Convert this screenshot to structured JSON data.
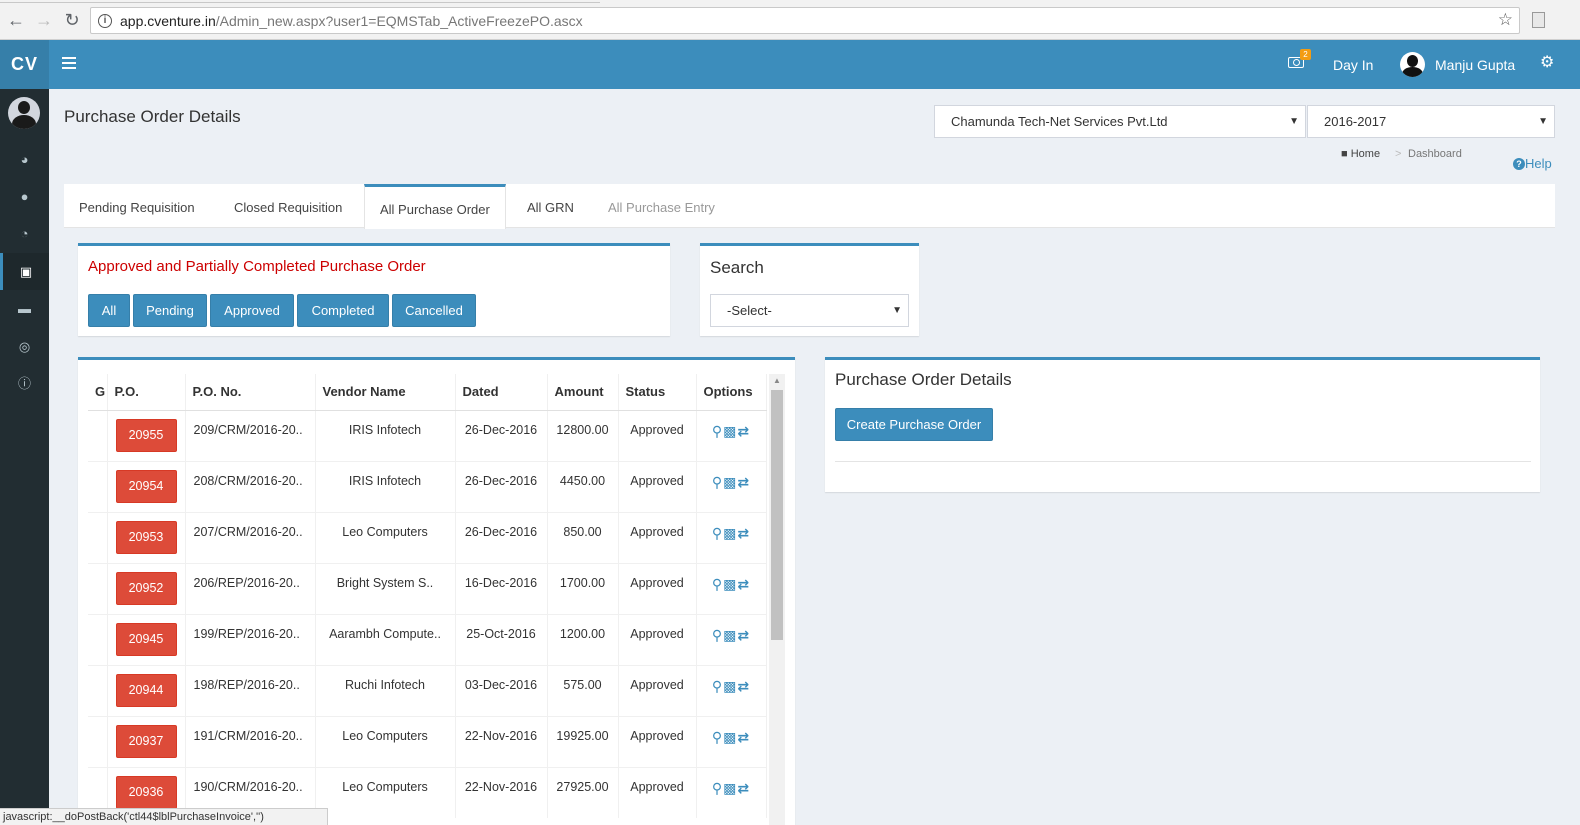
{
  "browser": {
    "url_host": "app.cventure.in",
    "url_path": "/Admin_new.aspx?user1=EQMSTab_ActiveFreezePO.ascx"
  },
  "header": {
    "logo": "CV",
    "notification_count": "2",
    "day_in": "Day In",
    "user_name": "Manju Gupta"
  },
  "sidebar": {
    "items": [
      {
        "icon": "dashboard-icon"
      },
      {
        "icon": "user-icon"
      },
      {
        "icon": "pie-chart-icon"
      },
      {
        "icon": "shopping-cart-icon",
        "active": true
      },
      {
        "icon": "credit-card-icon"
      },
      {
        "icon": "globe-icon"
      },
      {
        "icon": "info-icon"
      }
    ]
  },
  "page": {
    "title": "Purchase Order Details",
    "company_select": "Chamunda Tech-Net Services Pvt.Ltd",
    "year_select": "2016-2017",
    "breadcrumb_home": "Home",
    "breadcrumb_sep": ">",
    "breadcrumb_current": "Dashboard",
    "help": "Help"
  },
  "tabs": [
    {
      "label": "Pending Requisition"
    },
    {
      "label": "Closed Requisition"
    },
    {
      "label": "All Purchase Order"
    },
    {
      "label": "All GRN"
    },
    {
      "label": "All Purchase Entry"
    }
  ],
  "filter": {
    "title": "Approved and Partially Completed Purchase Order",
    "buttons": [
      "All",
      "Pending",
      "Approved",
      "Completed",
      "Cancelled"
    ]
  },
  "search": {
    "title": "Search",
    "select_value": "-Select-"
  },
  "table": {
    "headers": [
      "G",
      "P.O.",
      "P.O. No.",
      "Vendor Name",
      "Dated",
      "Amount",
      "Status",
      "Options"
    ],
    "rows": [
      {
        "po": "20955",
        "po_no": "209/CRM/2016-20..",
        "vendor": "IRIS Infotech",
        "dated": "26-Dec-2016",
        "amount": "12800.00",
        "status": "Approved"
      },
      {
        "po": "20954",
        "po_no": "208/CRM/2016-20..",
        "vendor": "IRIS Infotech",
        "dated": "26-Dec-2016",
        "amount": "4450.00",
        "status": "Approved"
      },
      {
        "po": "20953",
        "po_no": "207/CRM/2016-20..",
        "vendor": "Leo Computers",
        "dated": "26-Dec-2016",
        "amount": "850.00",
        "status": "Approved"
      },
      {
        "po": "20952",
        "po_no": "206/REP/2016-20..",
        "vendor": "Bright System S..",
        "dated": "16-Dec-2016",
        "amount": "1700.00",
        "status": "Approved"
      },
      {
        "po": "20945",
        "po_no": "199/REP/2016-20..",
        "vendor": "Aarambh Compute..",
        "dated": "25-Oct-2016",
        "amount": "1200.00",
        "status": "Approved"
      },
      {
        "po": "20944",
        "po_no": "198/REP/2016-20..",
        "vendor": "Ruchi Infotech",
        "dated": "03-Dec-2016",
        "amount": "575.00",
        "status": "Approved"
      },
      {
        "po": "20937",
        "po_no": "191/CRM/2016-20..",
        "vendor": "Leo Computers",
        "dated": "22-Nov-2016",
        "amount": "19925.00",
        "status": "Approved"
      },
      {
        "po": "20936",
        "po_no": "190/CRM/2016-20..",
        "vendor": "Leo Computers",
        "dated": "22-Nov-2016",
        "amount": "27925.00",
        "status": "Approved"
      }
    ]
  },
  "details": {
    "title": "Purchase Order Details",
    "create_button": "Create Purchase Order"
  },
  "statusbar": "javascript:__doPostBack('ctl44$lblPurchaseInvoice','')",
  "colors": {
    "primary": "#3c8dbc",
    "danger": "#dd4b39",
    "sidebar": "#222d32",
    "filter_title": "#cc0000"
  }
}
